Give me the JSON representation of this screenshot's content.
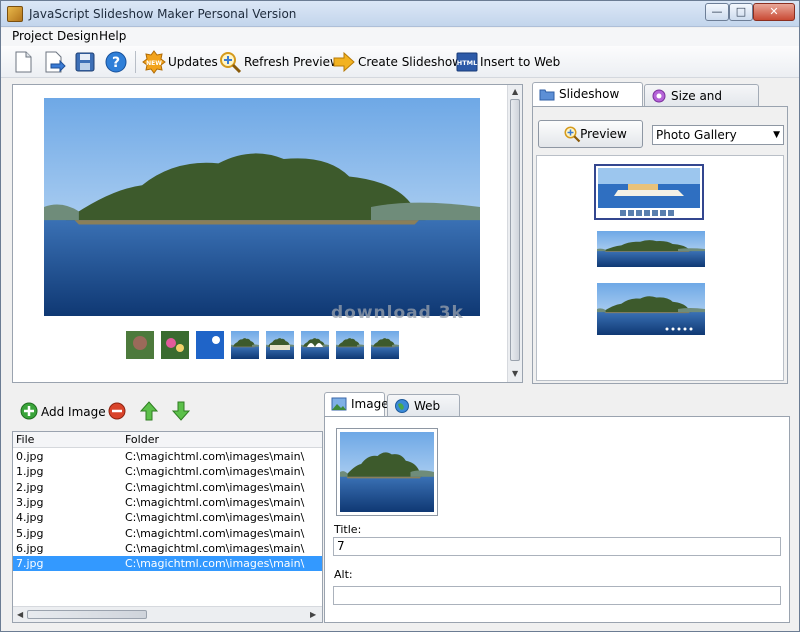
{
  "window": {
    "title": "JavaScript Slideshow Maker Personal Version"
  },
  "menu": [
    "Project",
    "Design",
    "Help"
  ],
  "toolbar": {
    "updates": "Updates",
    "refresh": "Refresh Preview",
    "create": "Create Slideshow",
    "insert": "Insert to Web"
  },
  "style_panel": {
    "tab_style": "Slideshow Style",
    "tab_size": "Size and Options",
    "preview_button": "Preview",
    "gallery_select": "Photo Gallery"
  },
  "watermark": "download 3k",
  "images": {
    "add_label": "Add Image",
    "columns": {
      "file": "File",
      "folder": "Folder"
    },
    "rows": [
      {
        "file": "0.jpg",
        "folder": "C:\\magichtml.com\\images\\main\\"
      },
      {
        "file": "1.jpg",
        "folder": "C:\\magichtml.com\\images\\main\\"
      },
      {
        "file": "2.jpg",
        "folder": "C:\\magichtml.com\\images\\main\\"
      },
      {
        "file": "3.jpg",
        "folder": "C:\\magichtml.com\\images\\main\\"
      },
      {
        "file": "4.jpg",
        "folder": "C:\\magichtml.com\\images\\main\\"
      },
      {
        "file": "5.jpg",
        "folder": "C:\\magichtml.com\\images\\main\\"
      },
      {
        "file": "6.jpg",
        "folder": "C:\\magichtml.com\\images\\main\\"
      },
      {
        "file": "7.jpg",
        "folder": "C:\\magichtml.com\\images\\main\\"
      }
    ],
    "selected_index": 7
  },
  "details": {
    "tab_image": "Image",
    "tab_weblink": "Web Link",
    "title_label": "Title:",
    "title_value": "7",
    "alt_label": "Alt:",
    "alt_value": ""
  }
}
